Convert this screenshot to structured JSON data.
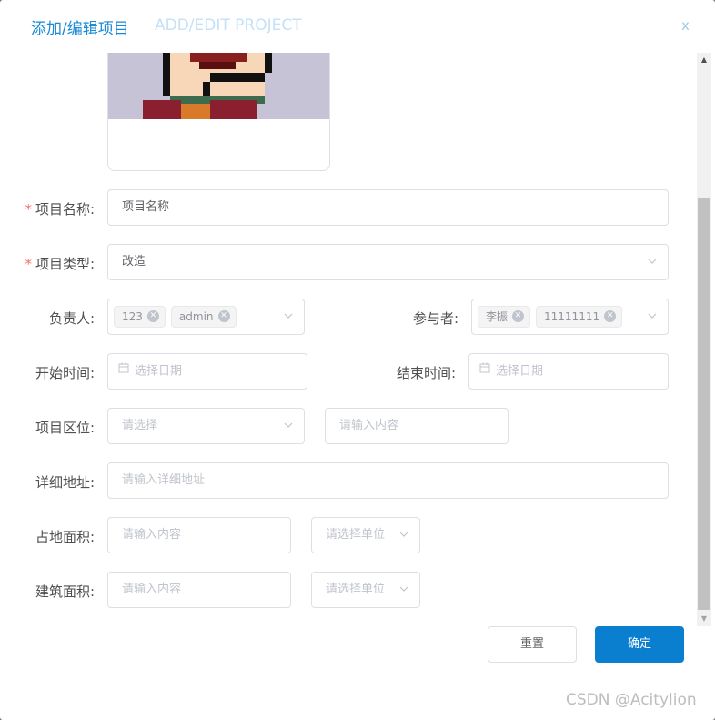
{
  "dialog": {
    "title_cn": "添加/编辑项目",
    "title_en": "ADD/EDIT PROJECT",
    "close_label": "x"
  },
  "form": {
    "project_name": {
      "label": "项目名称:",
      "value": "项目名称",
      "required": true
    },
    "project_type": {
      "label": "项目类型:",
      "value": "改造",
      "required": true
    },
    "owner": {
      "label": "负责人:",
      "tags": [
        "123",
        "admin"
      ]
    },
    "participants": {
      "label": "参与者:",
      "tags": [
        "李振",
        "11111111"
      ]
    },
    "start_time": {
      "label": "开始时间:",
      "placeholder": "选择日期"
    },
    "end_time": {
      "label": "结束时间:",
      "placeholder": "选择日期"
    },
    "region": {
      "label": "项目区位:",
      "select_placeholder": "请选择",
      "input_placeholder": "请输入内容"
    },
    "address": {
      "label": "详细地址:",
      "placeholder": "请输入详细地址"
    },
    "land_area": {
      "label": "占地面积:",
      "input_placeholder": "请输入内容",
      "unit_placeholder": "请选择单位"
    },
    "building_area": {
      "label": "建筑面积:",
      "input_placeholder": "请输入内容",
      "unit_placeholder": "请选择单位"
    }
  },
  "buttons": {
    "reset": "重置",
    "confirm": "确定"
  },
  "watermark": "CSDN @Acitylion",
  "colors": {
    "primary": "#0a7fd0",
    "title": "#1a8ad4",
    "required": "#f56c6c"
  }
}
